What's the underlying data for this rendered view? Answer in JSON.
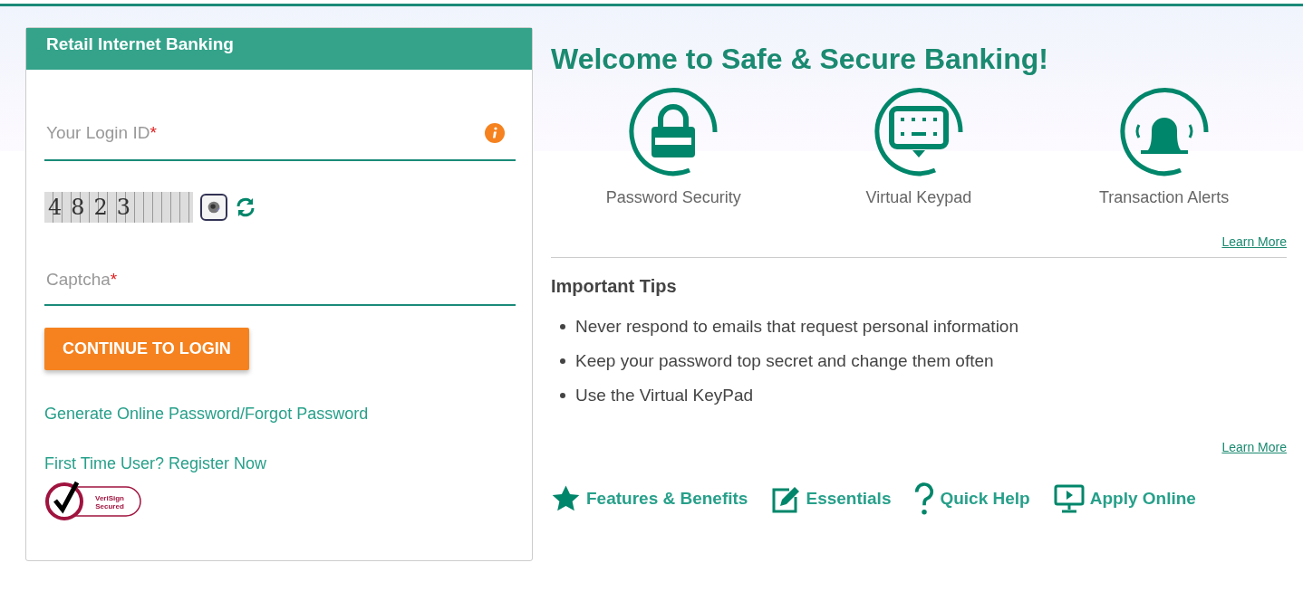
{
  "login": {
    "title": "Retail Internet Banking",
    "login_id": {
      "placeholder": "Your Login ID",
      "required": "*"
    },
    "captcha_image": "4823",
    "captcha": {
      "placeholder": "Captcha",
      "required": "*"
    },
    "button": "CONTINUE TO LOGIN",
    "links": [
      "Generate Online Password/Forgot Password",
      "First Time User? Register Now"
    ],
    "seal": [
      "VeriSign",
      "Secured"
    ]
  },
  "welcome": {
    "title": "Welcome to Safe & Secure Banking!",
    "features": [
      {
        "kind": "lock",
        "label": "Password Security"
      },
      {
        "kind": "keypad",
        "label": "Virtual Keypad"
      },
      {
        "kind": "bell",
        "label": "Transaction Alerts"
      }
    ],
    "learn_more": "Learn More"
  },
  "tips": {
    "title": "Important Tips",
    "items": [
      "Never respond to emails that request personal information",
      "Keep your password top secret and change them often",
      "Use the Virtual KeyPad"
    ],
    "learn_more": "Learn More"
  },
  "quick_links": [
    {
      "kind": "star",
      "label": "Features & Benefits"
    },
    {
      "kind": "edit",
      "label": "Essentials"
    },
    {
      "kind": "help",
      "label": "Quick Help"
    },
    {
      "kind": "monitor",
      "label": "Apply Online"
    }
  ]
}
